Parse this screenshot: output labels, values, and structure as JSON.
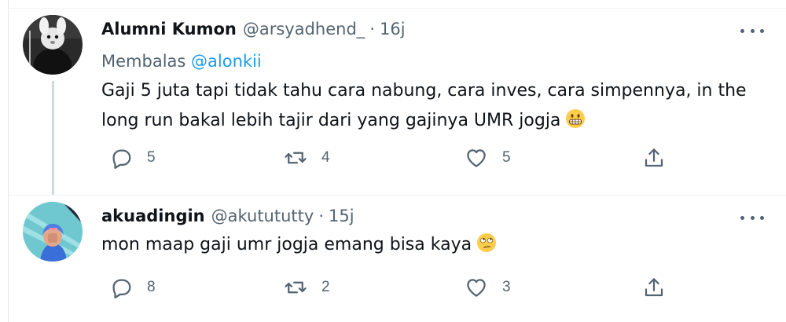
{
  "tweets": [
    {
      "display_name": "Alumni Kumon",
      "handle": "@arsyadhend_",
      "separator": "·",
      "time": "16j",
      "replying_prefix": "Membalas",
      "replying_to": "@alonkii",
      "text_line1": "Gaji 5 juta tapi tidak tahu cara nabung, cara inves, cara simpennya, in the",
      "text_line2": "long run bakal lebih tajir dari yang gajinya UMR jogja",
      "emoji": "grimacing-face-emoji",
      "replies": "5",
      "retweets": "4",
      "likes": "5"
    },
    {
      "display_name": "akuadingin",
      "handle": "@akutututty",
      "separator": "·",
      "time": "15j",
      "text": "mon maap gaji umr jogja emang bisa kaya",
      "emoji": "face-with-rolling-eyes-emoji",
      "replies": "8",
      "retweets": "2",
      "likes": "3"
    }
  ],
  "colors": {
    "text": "#0f1419",
    "secondary": "#536471",
    "link": "#1d9bf0",
    "thread_line": "#cfd9de",
    "divider": "#eff3f4"
  }
}
